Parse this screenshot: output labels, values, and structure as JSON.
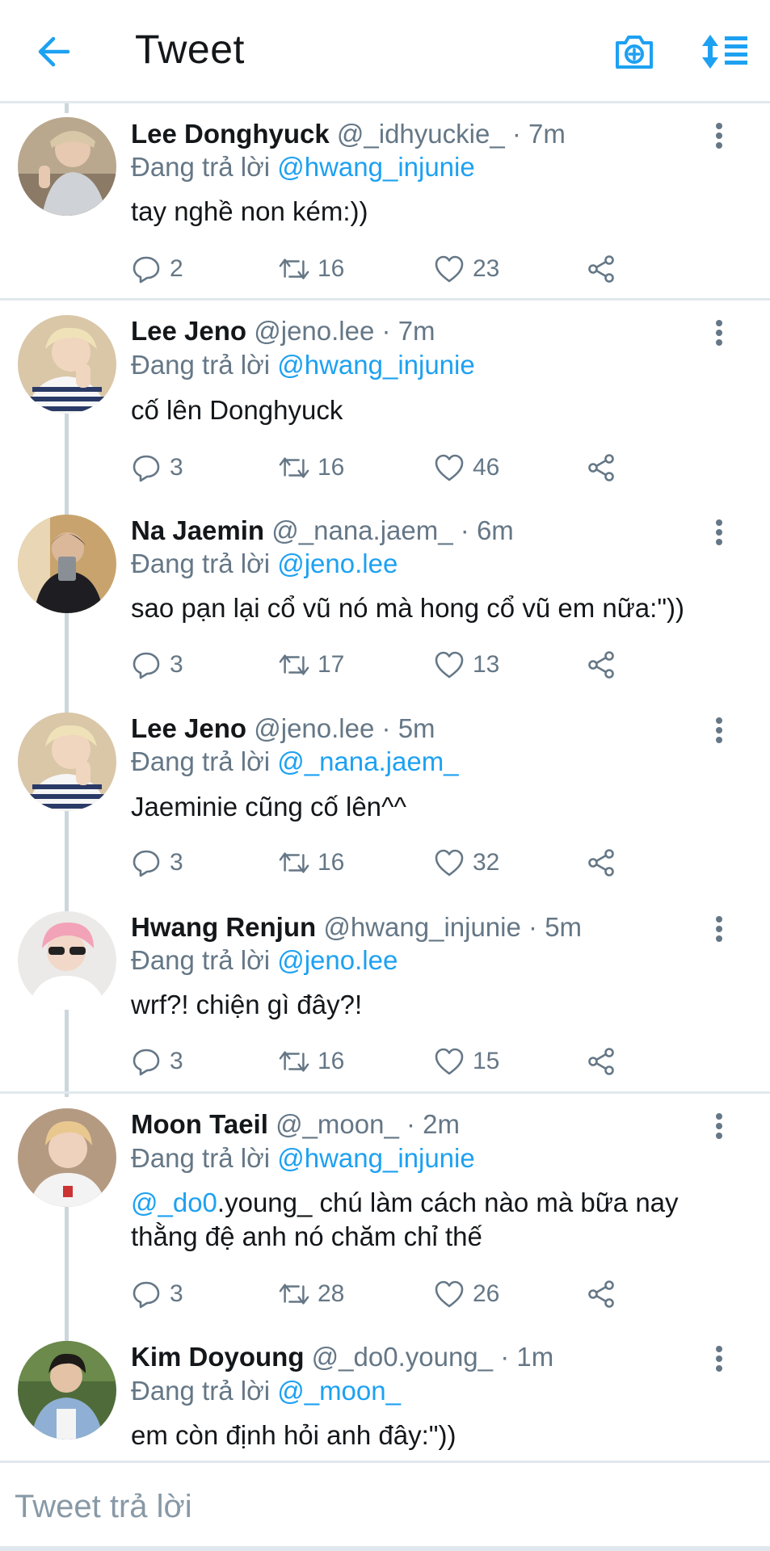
{
  "header": {
    "title": "Tweet",
    "accent_color": "#1da1f2",
    "icons": [
      "back-arrow-icon",
      "camera-plus-icon",
      "sort-list-icon"
    ]
  },
  "reply_prefix": "Đang trả lời",
  "tweets": [
    {
      "name": "Lee Donghyuck",
      "handle": "@_idhyuckie_",
      "sep": "·",
      "time": "7m",
      "reply_to": "@hwang_injunie",
      "text": "tay nghề non kém:))",
      "replies": "2",
      "retweets": "16",
      "likes": "23"
    },
    {
      "name": "Lee Jeno",
      "handle": "@jeno.lee",
      "sep": "·",
      "time": "7m",
      "reply_to": "@hwang_injunie",
      "text": "cố lên Donghyuck",
      "replies": "3",
      "retweets": "16",
      "likes": "46"
    },
    {
      "name": "Na Jaemin",
      "handle": "@_nana.jaem_",
      "sep": "·",
      "time": "6m",
      "reply_to": "@jeno.lee",
      "text": "sao pạn lại cổ vũ nó mà hong cổ vũ em nữa:\"))",
      "replies": "3",
      "retweets": "17",
      "likes": "13"
    },
    {
      "name": "Lee Jeno",
      "handle": "@jeno.lee",
      "sep": "·",
      "time": "5m",
      "reply_to": "@_nana.jaem_",
      "text": "Jaeminie cũng cố lên^^",
      "replies": "3",
      "retweets": "16",
      "likes": "32"
    },
    {
      "name": "Hwang Renjun",
      "handle": "@hwang_injunie",
      "sep": "·",
      "time": "5m",
      "reply_to": "@jeno.lee",
      "text": "wrf?! chiện gì đây?!",
      "replies": "3",
      "retweets": "16",
      "likes": "15"
    },
    {
      "name": "Moon Taeil",
      "handle": "@_moon_",
      "sep": "·",
      "time": "2m",
      "reply_to": "@hwang_injunie",
      "text_mention": "@_do0",
      "text": ".young_ chú làm cách nào mà bữa nay thằng đệ anh nó chăm chỉ thế",
      "replies": "3",
      "retweets": "28",
      "likes": "26"
    },
    {
      "name": "Kim Doyoung",
      "handle": "@_do0.young_",
      "sep": "·",
      "time": "1m",
      "reply_to": "@_moon_",
      "text": "em còn định hỏi anh đây:\"))"
    }
  ],
  "composer": {
    "placeholder": "Tweet trả lời"
  }
}
